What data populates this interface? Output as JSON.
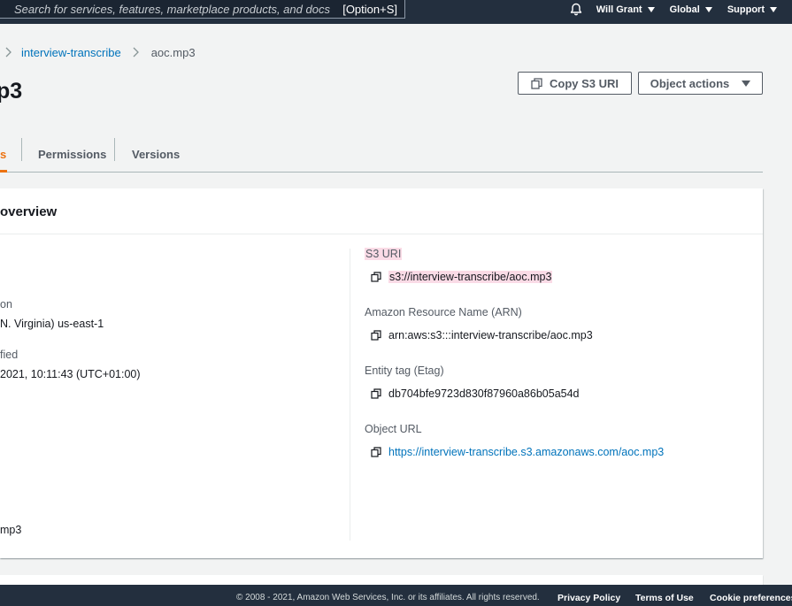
{
  "topnav": {
    "search_placeholder": "Search for services, features, marketplace products, and docs",
    "search_shortcut": "[Option+S]",
    "user_label": "Will Grant",
    "region_label": "Global",
    "support_label": "Support"
  },
  "breadcrumb": {
    "bucket": "interview-transcribe",
    "object": "aoc.mp3"
  },
  "page": {
    "title": "p3"
  },
  "header_actions": {
    "copy_s3_uri_label": "Copy S3 URI",
    "object_actions_label": "Object actions"
  },
  "tabs": {
    "active_partial": "s",
    "permissions": "Permissions",
    "versions": "Versions"
  },
  "overview": {
    "title": "overview",
    "left": {
      "region_label": "on",
      "region_value": "N. Virginia) us-east-1",
      "modified_label": "fied",
      "modified_value": "2021, 10:11:43 (UTC+01:00)",
      "type_value": "mp3"
    },
    "right": {
      "s3_uri_label": "S3 URI",
      "s3_uri_value": "s3://interview-transcribe/aoc.mp3",
      "arn_label": "Amazon Resource Name (ARN)",
      "arn_value": "arn:aws:s3:::interview-transcribe/aoc.mp3",
      "etag_label": "Entity tag (Etag)",
      "etag_value": "db704bfe9723d830f87960a86b05a54d",
      "url_label": "Object URL",
      "url_value": "https://interview-transcribe.s3.amazonaws.com/aoc.mp3"
    }
  },
  "footer": {
    "copyright": "© 2008 - 2021, Amazon Web Services, Inc. or its affiliates. All rights reserved.",
    "privacy": "Privacy Policy",
    "terms": "Terms of Use",
    "cookies": "Cookie preferences"
  },
  "colors": {
    "nav_bg": "#232f3e",
    "link": "#0073bb",
    "active_tab": "#ec7211",
    "highlight": "#fadbe6"
  }
}
